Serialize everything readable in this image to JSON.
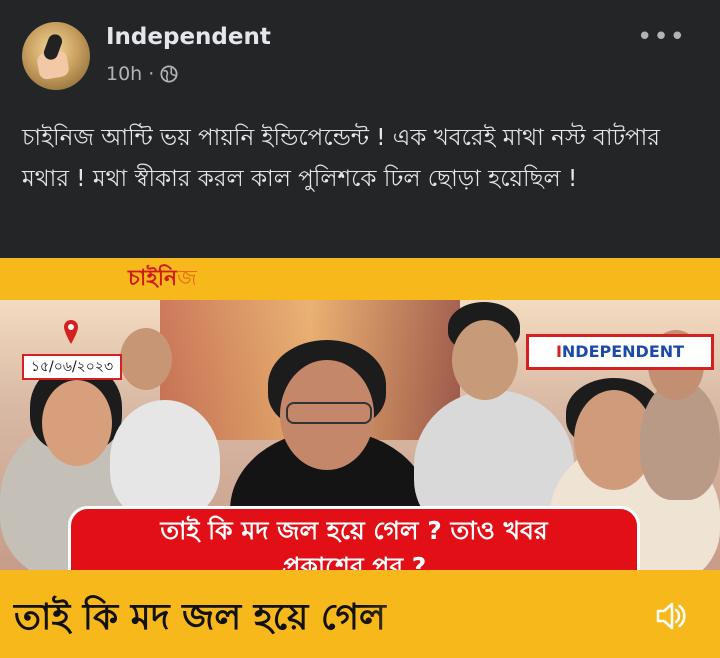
{
  "post": {
    "author": "Independent",
    "time": "10h",
    "audience_icon": "globe-icon",
    "more_icon": "more-options-icon",
    "text": "চাইনিজ আন্টি ভয় পায়নি ইন্ডিপেন্ডেন্ট ! এক খবরেই মাথা নস্ট বাটপার মথার ! মথা স্বীকার করল কাল পুলিশকে ঢিল ছোড়া হয়েছিল !"
  },
  "video": {
    "top_label_main": "চাইনি",
    "top_label_tail": "জ",
    "date": "১৫/০৬/২০২৩",
    "logo": "NDEPENDENT",
    "logo_letter": "I",
    "banner_line1": "তাই কি মদ জল হয়ে গেল ? তাও খবর",
    "banner_line2": "প্রকাশের পর ?",
    "ticker": "তাই কি মদ জল হয়ে গেল",
    "sound_icon": "speaker-icon",
    "colors": {
      "strip": "#f7b81b",
      "banner": "#e20f17",
      "logo_border": "#d42020"
    }
  }
}
